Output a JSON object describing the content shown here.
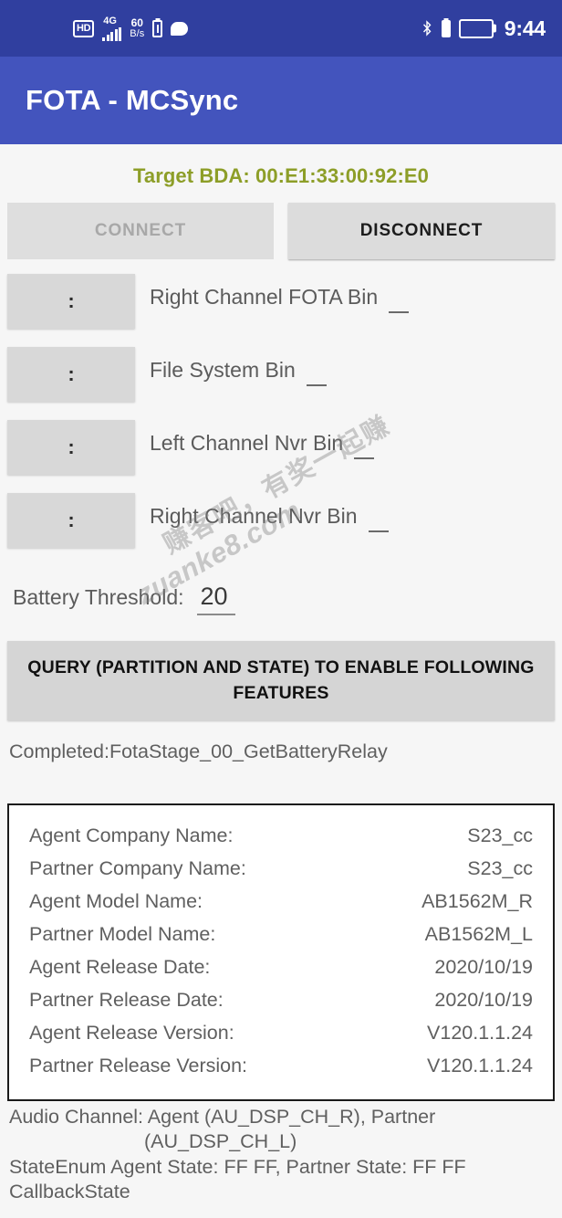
{
  "statusbar": {
    "hd_badge": "HD",
    "network_type": "4G",
    "net_speed_value": "60",
    "net_speed_unit": "B/s",
    "icons": [
      "hd-badge-icon",
      "signal-bars-icon",
      "network-speed-icon",
      "alarm-battery-icon",
      "message-bubble-icon",
      "bluetooth-icon",
      "battery-small-icon",
      "battery-icon"
    ],
    "clock": "9:44"
  },
  "appbar": {
    "title": "FOTA - MCSync"
  },
  "main": {
    "target_bda": "Target BDA: 00:E1:33:00:92:E0",
    "target_bda_color": "#8d9e28",
    "connect_label": "CONNECT",
    "disconnect_label": "DISCONNECT",
    "picker_glyph": ":",
    "file_rows": [
      {
        "label": "Right Channel FOTA Bin"
      },
      {
        "label": "File System Bin"
      },
      {
        "label": "Left Channel Nvr Bin"
      },
      {
        "label": "Right Channel Nvr Bin"
      }
    ],
    "battery_threshold_label": "Battery Threshold:",
    "battery_threshold_value": "20",
    "query_button_label": "QUERY (PARTITION AND STATE) TO ENABLE FOLLOWING FEATURES",
    "status_text": "Completed:FotaStage_00_GetBatteryRelay"
  },
  "info_table": [
    {
      "key": "Agent Company Name:",
      "value": "S23_cc"
    },
    {
      "key": "Partner Company Name:",
      "value": "S23_cc"
    },
    {
      "key": "Agent Model Name:",
      "value": "AB1562M_R"
    },
    {
      "key": "Partner Model Name:",
      "value": "AB1562M_L"
    },
    {
      "key": "Agent Release Date:",
      "value": "2020/10/19"
    },
    {
      "key": "Partner Release Date:",
      "value": "2020/10/19"
    },
    {
      "key": "Agent Release Version:",
      "value": "V120.1.1.24"
    },
    {
      "key": "Partner Release Version:",
      "value": "V120.1.1.24"
    }
  ],
  "footer": {
    "audio_channel_line1": "Audio Channel:  Agent (AU_DSP_CH_R), Partner",
    "audio_channel_line2": "(AU_DSP_CH_L)",
    "state_line": "StateEnum Agent State: FF FF, Partner State: FF FF",
    "callback_line": "CallbackState"
  },
  "watermark": {
    "line1": "赚客吧，有奖一起赚",
    "line2": "zuanke8.com"
  }
}
